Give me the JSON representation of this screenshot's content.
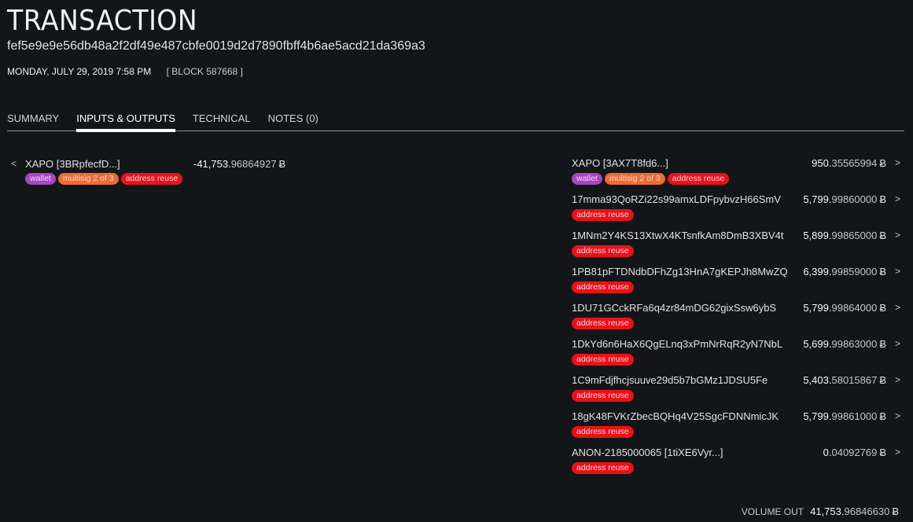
{
  "header": {
    "title": "TRANSACTION",
    "txid": "fef5e9e9e56db48a2f2df49e487cbfe0019d2d7890fbff4b6ae5acd21da369a3",
    "datetime": "MONDAY, JULY 29, 2019 7:58 PM",
    "block": "[ BLOCK 587668 ]"
  },
  "tabs": [
    {
      "label": "SUMMARY",
      "active": false
    },
    {
      "label": "INPUTS & OUTPUTS",
      "active": true
    },
    {
      "label": "TECHNICAL",
      "active": false
    },
    {
      "label": "NOTES (0)",
      "active": false
    }
  ],
  "currency_symbol": "Ƀ",
  "inputs": [
    {
      "chevron": "<",
      "address": "XAPO [3BRpfecfD...]",
      "amount_whole": "-41,753.",
      "amount_decimal": "96864927",
      "tags": [
        {
          "label": "wallet",
          "type": "wallet",
          "color": "#a845c4"
        },
        {
          "label": "multisig 2 of 3",
          "type": "multisig",
          "color": "#f06a35"
        },
        {
          "label": "address reuse",
          "type": "reuse",
          "color": "#e9121a"
        }
      ]
    }
  ],
  "outputs": [
    {
      "address": "XAPO [3AX7T8fd6...]",
      "amount_whole": "950.",
      "amount_decimal": "35565994",
      "chevron": ">",
      "tags": [
        {
          "label": "wallet",
          "type": "wallet"
        },
        {
          "label": "multisig 2 of 3",
          "type": "multisig"
        },
        {
          "label": "address reuse",
          "type": "reuse"
        }
      ]
    },
    {
      "address": "17mma93QoRZi22s99amxLDFpybvzH66SmV",
      "amount_whole": "5,799.",
      "amount_decimal": "99860000",
      "chevron": ">",
      "tags": [
        {
          "label": "address reuse",
          "type": "reuse"
        }
      ]
    },
    {
      "address": "1MNm2Y4KS13XtwX4KTsnfkAm8DmB3XBV4t",
      "amount_whole": "5,899.",
      "amount_decimal": "99865000",
      "chevron": ">",
      "tags": [
        {
          "label": "address reuse",
          "type": "reuse"
        }
      ]
    },
    {
      "address": "1PB81pFTDNdbDFhZg13HnA7gKEPJh8MwZQ",
      "amount_whole": "6,399.",
      "amount_decimal": "99859000",
      "chevron": ">",
      "tags": [
        {
          "label": "address reuse",
          "type": "reuse"
        }
      ]
    },
    {
      "address": "1DU71GCckRFa6q4zr84mDG62gixSsw6ybS",
      "amount_whole": "5,799.",
      "amount_decimal": "99864000",
      "chevron": ">",
      "tags": [
        {
          "label": "address reuse",
          "type": "reuse"
        }
      ]
    },
    {
      "address": "1DkYd6n6HaX6QgELnq3xPmNrRqR2yN7NbL",
      "amount_whole": "5,699.",
      "amount_decimal": "99863000",
      "chevron": ">",
      "tags": [
        {
          "label": "address reuse",
          "type": "reuse"
        }
      ]
    },
    {
      "address": "1C9mFdjfhcjsuuve29d5b7bGMz1JDSU5Fe",
      "amount_whole": "5,403.",
      "amount_decimal": "58015867",
      "chevron": ">",
      "tags": [
        {
          "label": "address reuse",
          "type": "reuse"
        }
      ]
    },
    {
      "address": "18gK48FVKrZbecBQHq4V25SgcFDNNmicJK",
      "amount_whole": "5,799.",
      "amount_decimal": "99861000",
      "chevron": ">",
      "tags": [
        {
          "label": "address reuse",
          "type": "reuse"
        }
      ]
    },
    {
      "address": "ANON-2185000065 [1tiXE6Vyr...]",
      "amount_whole": "0.",
      "amount_decimal": "04092769",
      "chevron": ">",
      "tags": [
        {
          "label": "address reuse",
          "type": "reuse"
        }
      ]
    }
  ],
  "volume_out": {
    "label": "VOLUME OUT",
    "amount_whole": "41,753.",
    "amount_decimal": "96846630"
  }
}
